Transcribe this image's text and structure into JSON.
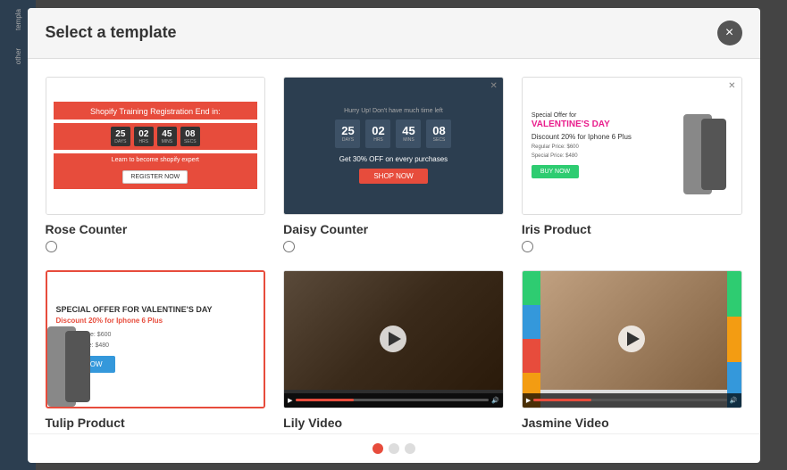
{
  "modal": {
    "title": "Select a template",
    "close_label": "×"
  },
  "templates": [
    {
      "id": "rose-counter",
      "name": "Rose Counter",
      "type": "counter",
      "selected": false,
      "preview": {
        "heading": "Shopify Training Registration End in:",
        "days": "25",
        "hrs": "02",
        "mins": "45",
        "secs": "08",
        "tagline": "Learn to become shopify expert",
        "button": "REGISTER NOW"
      }
    },
    {
      "id": "daisy-counter",
      "name": "Daisy Counter",
      "type": "counter",
      "selected": false,
      "preview": {
        "hurry": "Hurry Up! Don't have much time left",
        "days": "25",
        "hrs": "02",
        "mins": "45",
        "secs": "08",
        "offer": "Get 30% OFF on every purchases",
        "button": "SHOP NOW"
      }
    },
    {
      "id": "iris-product",
      "name": "Iris Product",
      "type": "product",
      "selected": false,
      "preview": {
        "special": "Special Offer for",
        "holiday": "VALENTINE'S DAY",
        "discount": "Discount 20% for Iphone 6 Plus",
        "regular": "Regular Price: $600",
        "special_price": "Special Price: $480",
        "button": "BUY NOW"
      }
    },
    {
      "id": "tulip-product",
      "name": "Tulip Product",
      "type": "product",
      "selected": true,
      "preview": {
        "header": "SPECIAL OFFER FOR VALENTINE'S DAY",
        "discount": "Discount 20% for Iphone 6 Plus",
        "regular": "Regular Price: $600",
        "special_price": "Special price: $480",
        "button": "BUY NOW"
      }
    },
    {
      "id": "lily-video",
      "name": "Lily Video",
      "type": "video",
      "selected": false
    },
    {
      "id": "jasmine-video",
      "name": "Jasmine Video",
      "type": "video",
      "selected": false
    }
  ],
  "pagination": {
    "current": 1,
    "total": 3,
    "dots": [
      "active",
      "inactive",
      "inactive"
    ]
  },
  "sidebar": {
    "items": [
      "templa",
      "other"
    ]
  },
  "countdown_labels": {
    "days": "DAYS",
    "hrs": "HRS",
    "mins": "MINS",
    "secs": "SECS"
  }
}
